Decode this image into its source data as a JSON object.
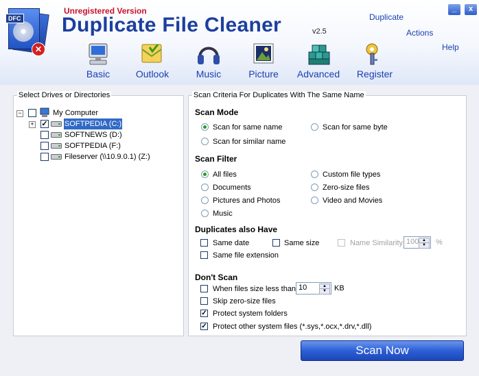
{
  "header": {
    "unregistered": "Unregistered Version",
    "title": "Duplicate File Cleaner",
    "version": "v2.5",
    "logo_tag": "DFC",
    "links": {
      "duplicate": "Duplicate",
      "actions": "Actions",
      "help": "Help"
    },
    "window_buttons": {
      "minimize": "_",
      "close": "x"
    }
  },
  "nav": [
    {
      "label": "Basic",
      "icon": "computer-icon"
    },
    {
      "label": "Outlook",
      "icon": "envelope-icon"
    },
    {
      "label": "Music",
      "icon": "headphones-icon"
    },
    {
      "label": "Picture",
      "icon": "picture-icon"
    },
    {
      "label": "Advanced",
      "icon": "cubes-icon"
    },
    {
      "label": "Register",
      "icon": "key-icon"
    }
  ],
  "drives": {
    "title": "Select Drives or Directories",
    "root": "My Computer",
    "items": [
      {
        "label": "SOFTPEDIA (C:)",
        "checked": true,
        "selected": true
      },
      {
        "label": "SOFTNEWS (D:)",
        "checked": false
      },
      {
        "label": "SOFTPEDIA (F:)",
        "checked": false
      },
      {
        "label": "Fileserver (\\\\10.9.0.1) (Z:)",
        "checked": false
      }
    ]
  },
  "criteria": {
    "title": "Scan Criteria For Duplicates With The Same Name",
    "scan_mode": {
      "title": "Scan Mode",
      "options": [
        "Scan for same name",
        "Scan for same byte",
        "Scan for similar name"
      ],
      "selected": "Scan for same name"
    },
    "scan_filter": {
      "title": "Scan Filter",
      "options": [
        "All files",
        "Custom file types",
        "Documents",
        "Zero-size files",
        "Pictures and Photos",
        "Video and Movies",
        "Music"
      ],
      "selected": "All files"
    },
    "duplicates": {
      "title": "Duplicates also Have",
      "same_date": "Same date",
      "same_size": "Same size",
      "name_similarity": "Name Similarity",
      "similarity_value": "100",
      "percent": "%",
      "same_ext": "Same file extension"
    },
    "dont_scan": {
      "title": "Don't Scan",
      "size_less": "When files size less than",
      "size_value": "10",
      "size_unit": "KB",
      "skip_zero": "Skip zero-size files",
      "protect_folders": "Protect system folders",
      "protect_files": "Protect other system files (*.sys,*.ocx,*.drv,*.dll)",
      "protect_folders_checked": true,
      "protect_files_checked": true
    }
  },
  "scan_button": "Scan Now",
  "colors": {
    "title_blue": "#1c3f9e",
    "unregistered_red": "#c8102e",
    "selection": "#316ac5",
    "check_green": "#21a121"
  }
}
